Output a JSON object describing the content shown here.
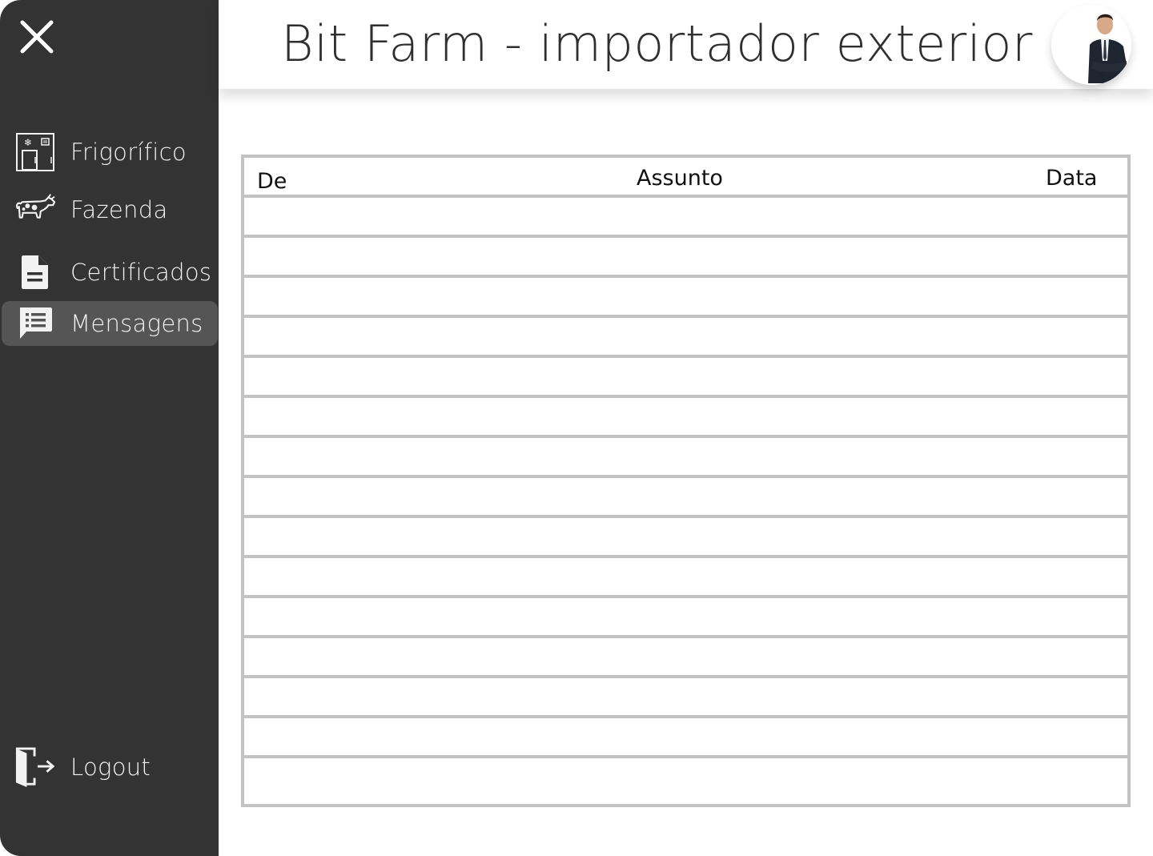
{
  "header": {
    "title": "Bit Farm - importador exterior"
  },
  "sidebar": {
    "items": [
      {
        "label": "Frigorífico",
        "icon": "refrigerator-icon"
      },
      {
        "label": "Fazenda",
        "icon": "cow-icon"
      },
      {
        "label": "Certificados",
        "icon": "document-icon"
      },
      {
        "label": "Mensagens",
        "icon": "message-icon",
        "active": true
      }
    ],
    "logout": {
      "label": "Logout",
      "icon": "logout-icon"
    }
  },
  "table": {
    "columns": [
      "De",
      "Assunto",
      "Data"
    ],
    "rows": [
      [
        "",
        "",
        ""
      ],
      [
        "",
        "",
        ""
      ],
      [
        "",
        "",
        ""
      ],
      [
        "",
        "",
        ""
      ],
      [
        "",
        "",
        ""
      ],
      [
        "",
        "",
        ""
      ],
      [
        "",
        "",
        ""
      ],
      [
        "",
        "",
        ""
      ],
      [
        "",
        "",
        ""
      ],
      [
        "",
        "",
        ""
      ],
      [
        "",
        "",
        ""
      ],
      [
        "",
        "",
        ""
      ],
      [
        "",
        "",
        ""
      ],
      [
        "",
        "",
        ""
      ],
      [
        "",
        "",
        ""
      ]
    ]
  },
  "colors": {
    "sidebar": "#333333",
    "active_item": "#555555",
    "table_border": "#c3c3c3"
  }
}
